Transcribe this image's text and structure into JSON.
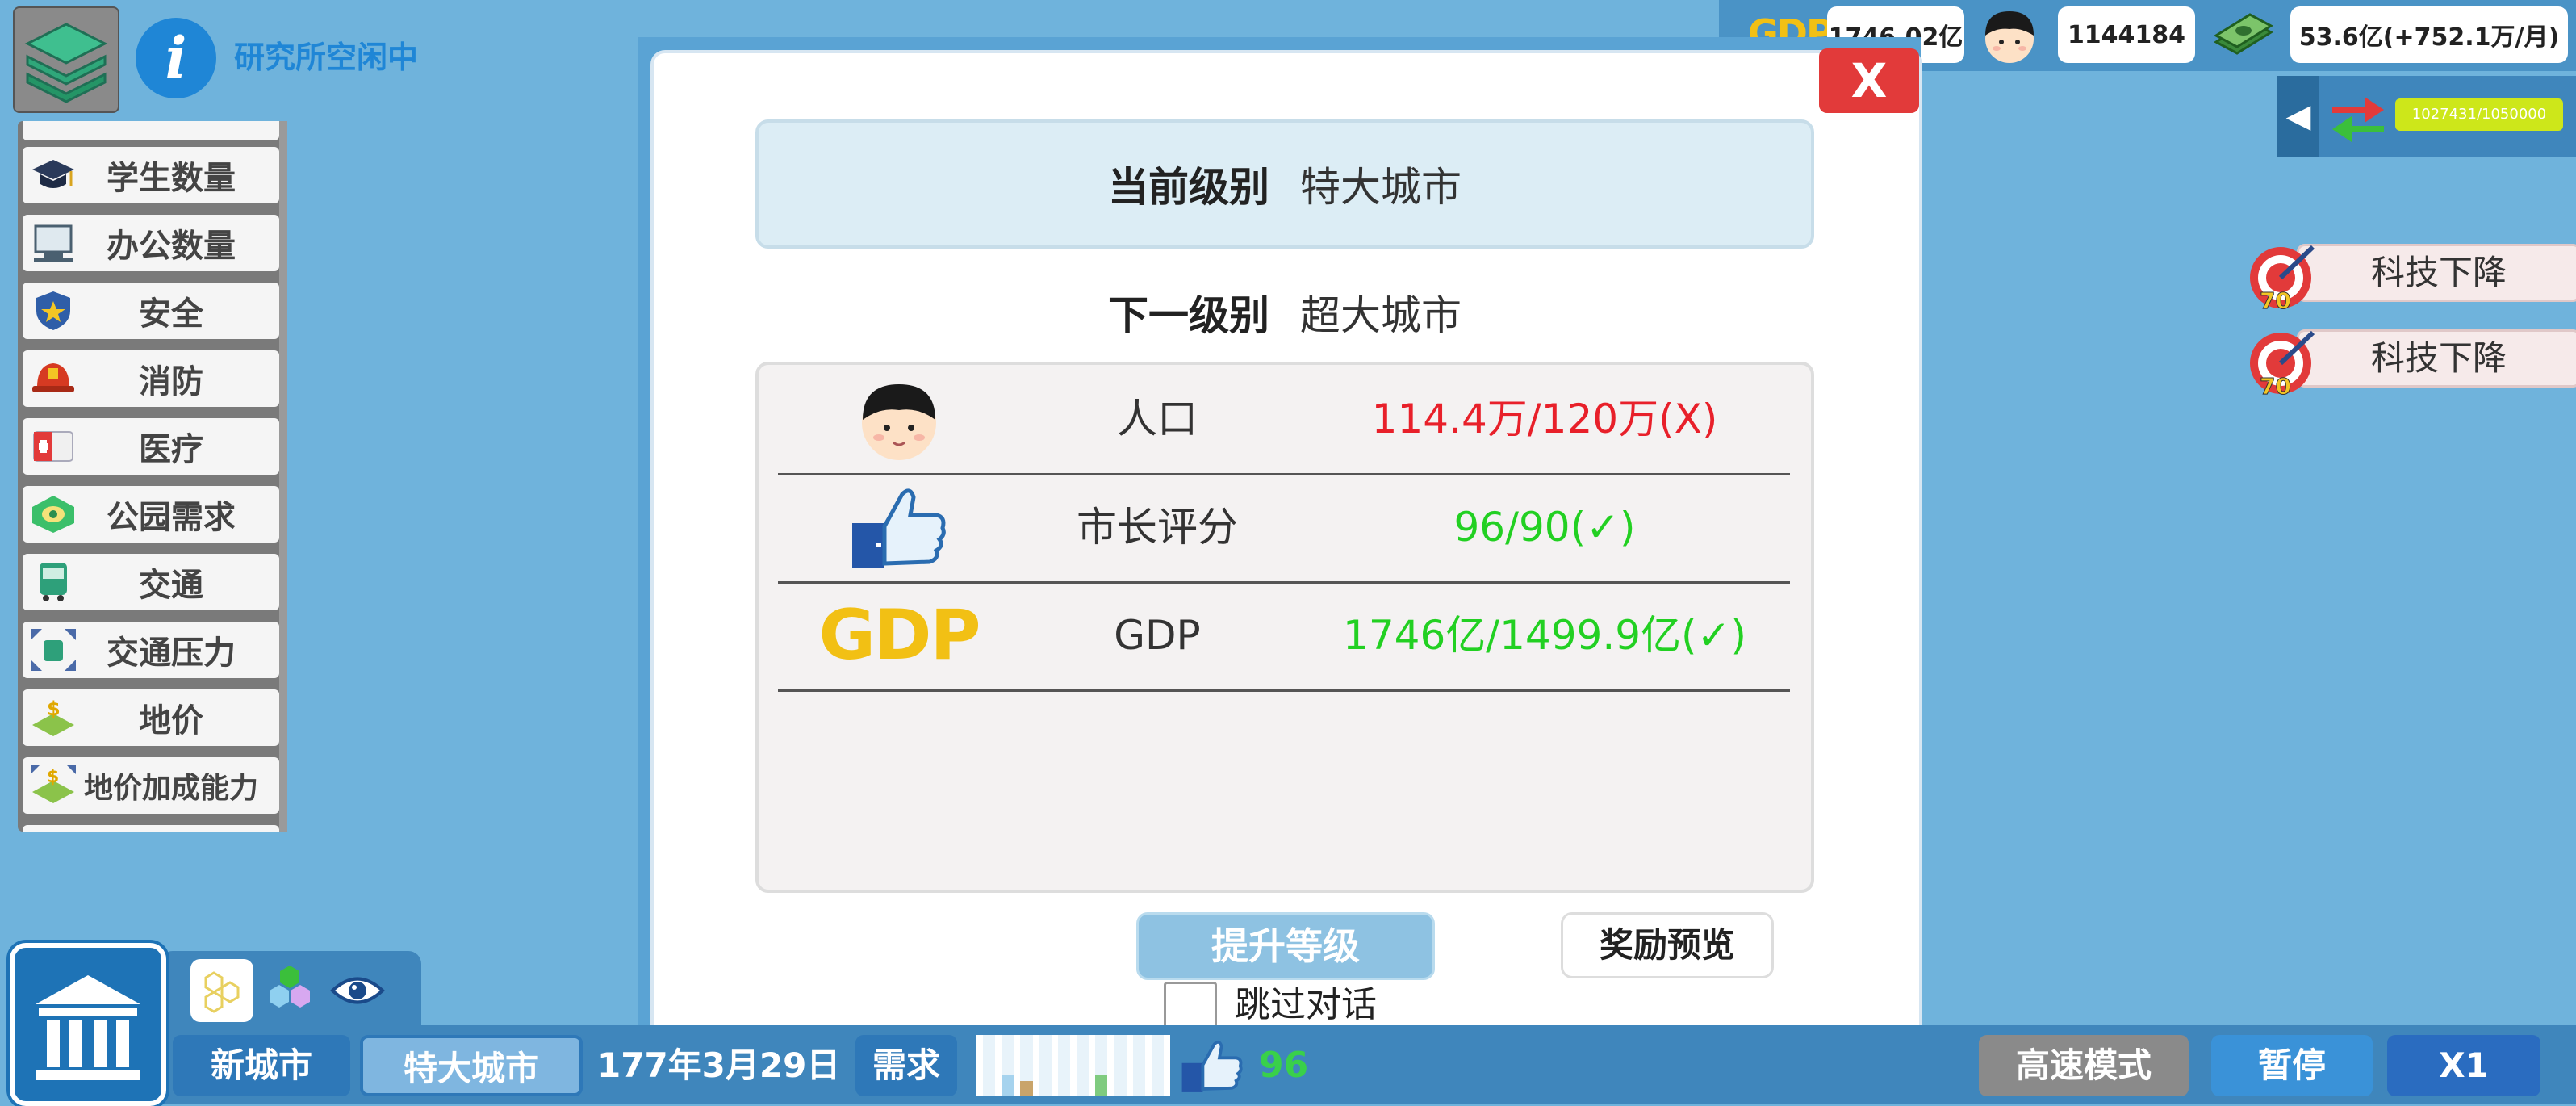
{
  "top_left": {
    "research_status": "研究所空闲中"
  },
  "filters": {
    "items": [
      {
        "label": "学生数量",
        "icon": "graduation-cap-icon"
      },
      {
        "label": "办公数量",
        "icon": "computer-icon"
      },
      {
        "label": "安全",
        "icon": "police-badge-icon"
      },
      {
        "label": "消防",
        "icon": "fire-helmet-icon"
      },
      {
        "label": "医疗",
        "icon": "medical-kit-icon"
      },
      {
        "label": "公园需求",
        "icon": "park-icon"
      },
      {
        "label": "交通",
        "icon": "bus-icon"
      },
      {
        "label": "交通压力",
        "icon": "traffic-pressure-icon"
      },
      {
        "label": "地价",
        "icon": "land-price-icon"
      },
      {
        "label": "地价加成能力",
        "icon": "land-bonus-icon"
      }
    ]
  },
  "status": {
    "gdp_logo": "GDP",
    "gdp": "1746.02亿",
    "population": "1144184",
    "money": "53.6亿(+752.1万/月)",
    "trade_progress": "1027431/1050000"
  },
  "tech_notices": [
    {
      "label": "科技下降",
      "badge": "70"
    },
    {
      "label": "科技下降",
      "badge": "70"
    }
  ],
  "dialog": {
    "close_label": "X",
    "current_level_key": "当前级别",
    "current_level_value": "特大城市",
    "next_level_key": "下一级别",
    "next_level_value": "超大城市",
    "requirements": [
      {
        "name": "人口",
        "value": "114.4万/120万(X)",
        "met": false,
        "icon": "population-face-icon"
      },
      {
        "name": "市长评分",
        "value": "96/90(✓)",
        "met": true,
        "icon": "thumbs-up-icon"
      },
      {
        "name": "GDP",
        "value": "1746亿/1499.9亿(✓)",
        "met": true,
        "icon": "gdp-logo-icon",
        "logo_text": "GDP"
      }
    ],
    "upgrade_label": "提升等级",
    "reward_label": "奖励预览",
    "skip_label": "跳过对话",
    "skip_checked": false
  },
  "bottom": {
    "new_city_label": "新城市",
    "city_level_label": "特大城市",
    "date": "177年3月29日",
    "demand_label": "需求",
    "demand_levels": [
      0.0,
      0.35,
      0.25,
      0.0,
      0.0,
      0.0,
      0.35,
      0.0,
      0.0,
      0.0
    ],
    "rating": "96",
    "fast_mode_label": "高速模式",
    "pause_label": "暂停",
    "speed_label": "X1"
  },
  "colors": {
    "background": "#6fb3dc",
    "met": "#22d022",
    "unmet": "#e8202a",
    "gdp_yellow": "#f2c014"
  }
}
